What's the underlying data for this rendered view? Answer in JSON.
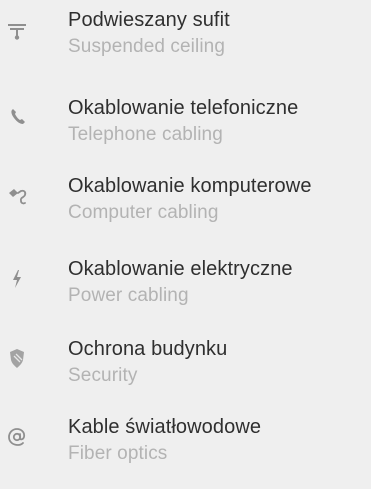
{
  "services": {
    "items": [
      {
        "icon": "ceiling-icon",
        "title": "Podwieszany sufit",
        "subtitle": "Suspended ceiling"
      },
      {
        "icon": "phone-icon",
        "title": "Okablowanie telefoniczne",
        "subtitle": "Telephone cabling"
      },
      {
        "icon": "network-cable-icon",
        "title": "Okablowanie komputerowe",
        "subtitle": "Computer cabling"
      },
      {
        "icon": "lightning-icon",
        "title": "Okablowanie elektryczne",
        "subtitle": "Power cabling"
      },
      {
        "icon": "shield-icon",
        "title": "Ochrona budynku",
        "subtitle": "Security"
      },
      {
        "icon": "at-sign-icon",
        "title": "Kable światłowodowe",
        "subtitle": "Fiber optics"
      }
    ]
  },
  "colors": {
    "background": "#efefef",
    "title": "#2f2f2f",
    "subtitle": "#b3b3b3",
    "icon": "#8f8f8f"
  }
}
